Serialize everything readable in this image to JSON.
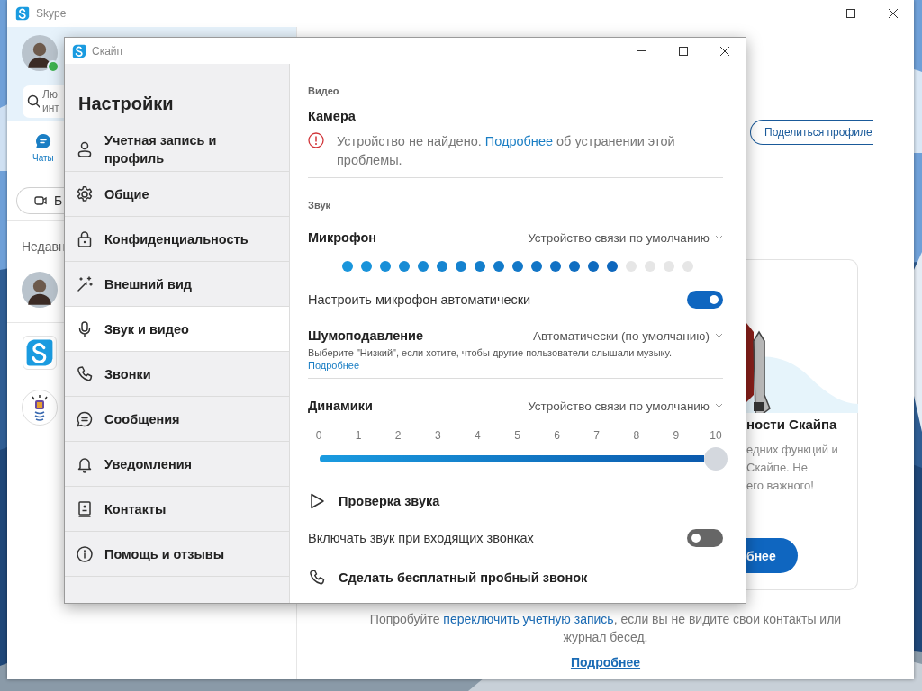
{
  "main_window": {
    "title": "Skype",
    "status": {
      "color": "#3fb34f"
    },
    "search": {
      "placeholder": "Лю инт"
    },
    "tabs": [
      {
        "label": "Чаты",
        "selected": true
      }
    ],
    "meet_button": "Б",
    "recent_heading": "Недавн",
    "share_button": "Поделиться профиле",
    "promo": {
      "title": "ности Скайпа",
      "lines": [
        "едних функций и",
        "Скайпе. Не",
        "его важного!"
      ],
      "button": "бнее"
    },
    "footer": {
      "text_before": "Попробуйте ",
      "link": "переключить учетную запись",
      "text_after": ", если вы не видите свои контакты или журнал бесед.",
      "more_link": "Подробнее"
    }
  },
  "dialog": {
    "title": "Скайп",
    "heading": "Настройки",
    "nav": [
      {
        "label": "Учетная запись и профиль",
        "selected": false
      },
      {
        "label": "Общие",
        "selected": false
      },
      {
        "label": "Конфиденциальность",
        "selected": false
      },
      {
        "label": "Внешний вид",
        "selected": false
      },
      {
        "label": "Звук и видео",
        "selected": true
      },
      {
        "label": "Звонки",
        "selected": false
      },
      {
        "label": "Сообщения",
        "selected": false
      },
      {
        "label": "Уведомления",
        "selected": false
      },
      {
        "label": "Контакты",
        "selected": false
      },
      {
        "label": "Помощь и отзывы",
        "selected": false
      }
    ],
    "content": [
      {
        "kind": "section",
        "label": "Видео"
      },
      {
        "kind": "heading",
        "label": "Камера"
      },
      {
        "kind": "error",
        "text_before": "Устройство не найдено. ",
        "link": "Подробнее",
        "text_after": " об устранении этой проблемы."
      },
      {
        "kind": "divider"
      },
      {
        "kind": "section",
        "label": "Звук"
      },
      {
        "kind": "device",
        "label": "Микрофон",
        "value": "Устройство связи по умолчанию"
      },
      {
        "kind": "meter",
        "level": 0.79
      },
      {
        "kind": "toggle",
        "label": "Настроить микрофон автоматически",
        "on": true
      },
      {
        "kind": "device",
        "label": "Шумоподавление",
        "value": "Автоматически (по умолчанию)",
        "hint": "Выберите \"Низкий\", если хотите, чтобы другие пользователи слышали музыку.",
        "link": "Подробнее"
      },
      {
        "kind": "divider"
      },
      {
        "kind": "device",
        "label": "Динамики",
        "value": "Устройство связи по умолчанию"
      },
      {
        "kind": "slider",
        "ticks": [
          "0",
          "1",
          "2",
          "3",
          "4",
          "5",
          "6",
          "7",
          "8",
          "9",
          "10"
        ],
        "level": 1
      },
      {
        "kind": "playback",
        "label": "Проверка звука"
      },
      {
        "kind": "toggle",
        "label": "Включать звук при входящих звонках",
        "on": false
      },
      {
        "kind": "call",
        "label": "Сделать бесплатный пробный звонок"
      }
    ]
  }
}
